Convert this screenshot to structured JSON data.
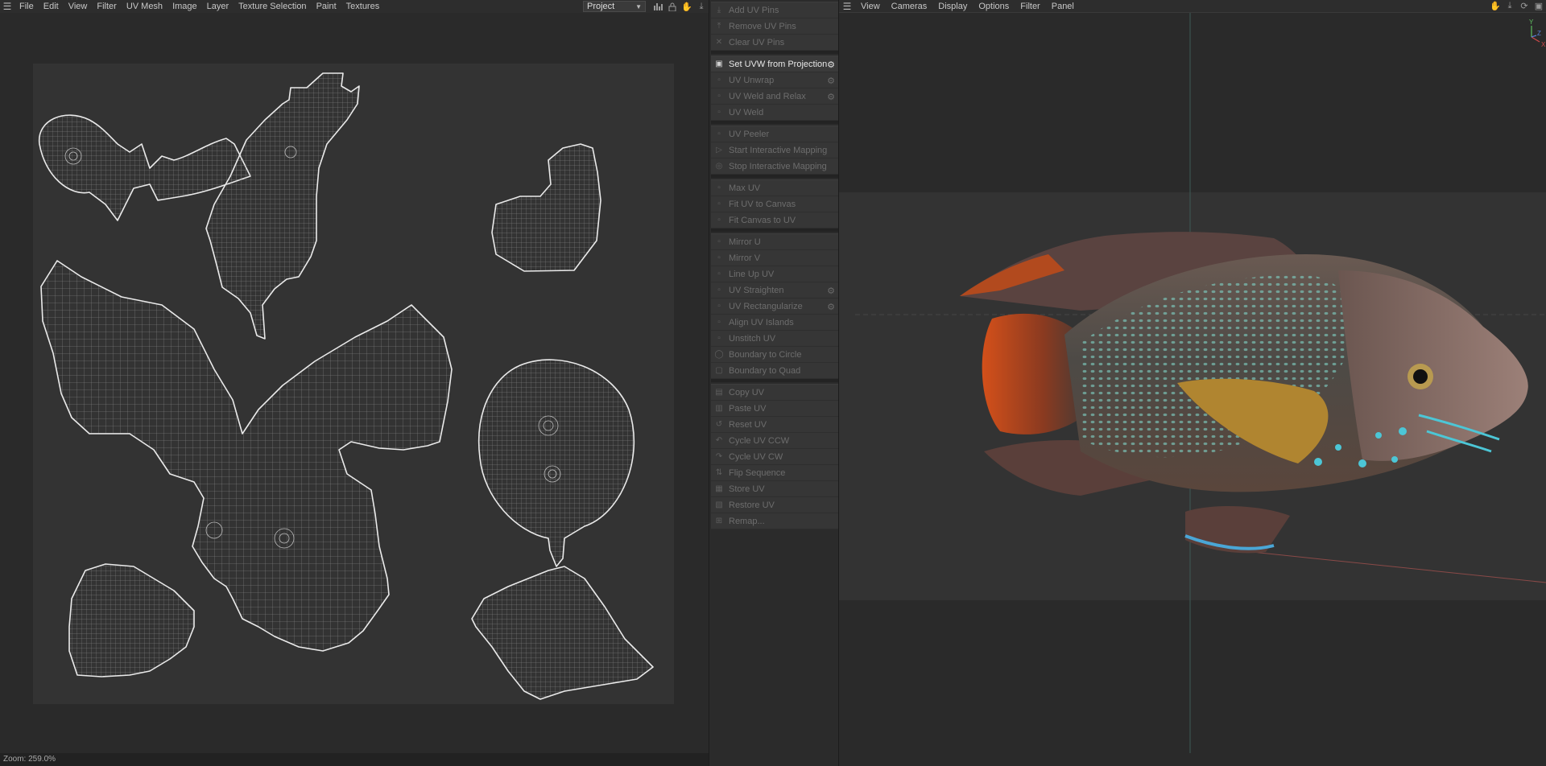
{
  "uv_editor": {
    "menu": [
      "File",
      "Edit",
      "View",
      "Filter",
      "UV Mesh",
      "Image",
      "Layer",
      "Texture Selection",
      "Paint",
      "Textures"
    ],
    "project_select": "Project",
    "toolbar_icons": [
      "histogram-icon",
      "lock-icon",
      "hand-icon",
      "pin-icon"
    ],
    "status": "Zoom: 259.0%"
  },
  "tool_panel": {
    "groups": [
      [
        {
          "label": "Add UV Pins",
          "icon": "pin-icon",
          "active": false
        },
        {
          "label": "Remove UV Pins",
          "icon": "pin-remove-icon",
          "active": false
        },
        {
          "label": "Clear UV Pins",
          "icon": "clear-icon",
          "active": false
        }
      ],
      [
        {
          "label": "Set UVW from Projection",
          "icon": "projection-icon",
          "active": true,
          "gear": true
        },
        {
          "label": "UV Unwrap",
          "icon": "unwrap-icon",
          "active": false,
          "gear": true
        },
        {
          "label": "UV Weld and Relax",
          "icon": "weld-relax-icon",
          "active": false,
          "gear": true
        },
        {
          "label": "UV Weld",
          "icon": "weld-icon",
          "active": false
        }
      ],
      [
        {
          "label": "UV Peeler",
          "icon": "peeler-icon",
          "active": false
        },
        {
          "label": "Start Interactive Mapping",
          "icon": "play-icon",
          "active": false
        },
        {
          "label": "Stop Interactive Mapping",
          "icon": "stop-icon",
          "active": false
        }
      ],
      [
        {
          "label": "Max UV",
          "icon": "max-uv-icon",
          "active": false
        },
        {
          "label": "Fit UV to Canvas",
          "icon": "fit-icon",
          "active": false
        },
        {
          "label": "Fit Canvas to UV",
          "icon": "fit-canvas-icon",
          "active": false
        }
      ],
      [
        {
          "label": "Mirror U",
          "icon": "mirror-u-icon",
          "active": false
        },
        {
          "label": "Mirror V",
          "icon": "mirror-v-icon",
          "active": false
        },
        {
          "label": "Line Up UV",
          "icon": "line-up-icon",
          "active": false
        },
        {
          "label": "UV Straighten",
          "icon": "straighten-icon",
          "active": false,
          "gear": true
        },
        {
          "label": "UV Rectangularize",
          "icon": "rectangularize-icon",
          "active": false,
          "gear": true
        },
        {
          "label": "Align UV Islands",
          "icon": "align-icon",
          "active": false
        },
        {
          "label": "Unstitch UV",
          "icon": "unstitch-icon",
          "active": false
        },
        {
          "label": "Boundary to Circle",
          "icon": "circle-icon",
          "active": false
        },
        {
          "label": "Boundary to Quad",
          "icon": "quad-icon",
          "active": false
        }
      ],
      [
        {
          "label": "Copy UV",
          "icon": "copy-icon",
          "active": false
        },
        {
          "label": "Paste UV",
          "icon": "paste-icon",
          "active": false
        },
        {
          "label": "Reset UV",
          "icon": "reset-icon",
          "active": false
        },
        {
          "label": "Cycle UV CCW",
          "icon": "ccw-icon",
          "active": false
        },
        {
          "label": "Cycle UV CW",
          "icon": "cw-icon",
          "active": false
        },
        {
          "label": "Flip Sequence",
          "icon": "flip-icon",
          "active": false
        },
        {
          "label": "Store UV",
          "icon": "store-icon",
          "active": false
        },
        {
          "label": "Restore UV",
          "icon": "restore-icon",
          "active": false
        },
        {
          "label": "Remap...",
          "icon": "remap-icon",
          "active": false
        }
      ]
    ]
  },
  "viewport": {
    "menu": [
      "View",
      "Cameras",
      "Display",
      "Options",
      "Filter",
      "Panel"
    ],
    "toolbar_icons": [
      "hand-icon",
      "move-icon",
      "rotate-icon",
      "layout-icon"
    ],
    "axis_labels": [
      "Y",
      "Z",
      "X"
    ]
  },
  "colors": {
    "accent_active": "#e8e8e8",
    "disabled": "#6d6d6d",
    "uv_wire": "#d8d8d8",
    "axis_x": "#d04a4a",
    "axis_y": "#5fbf5f",
    "axis_z": "#5a7fd8"
  }
}
